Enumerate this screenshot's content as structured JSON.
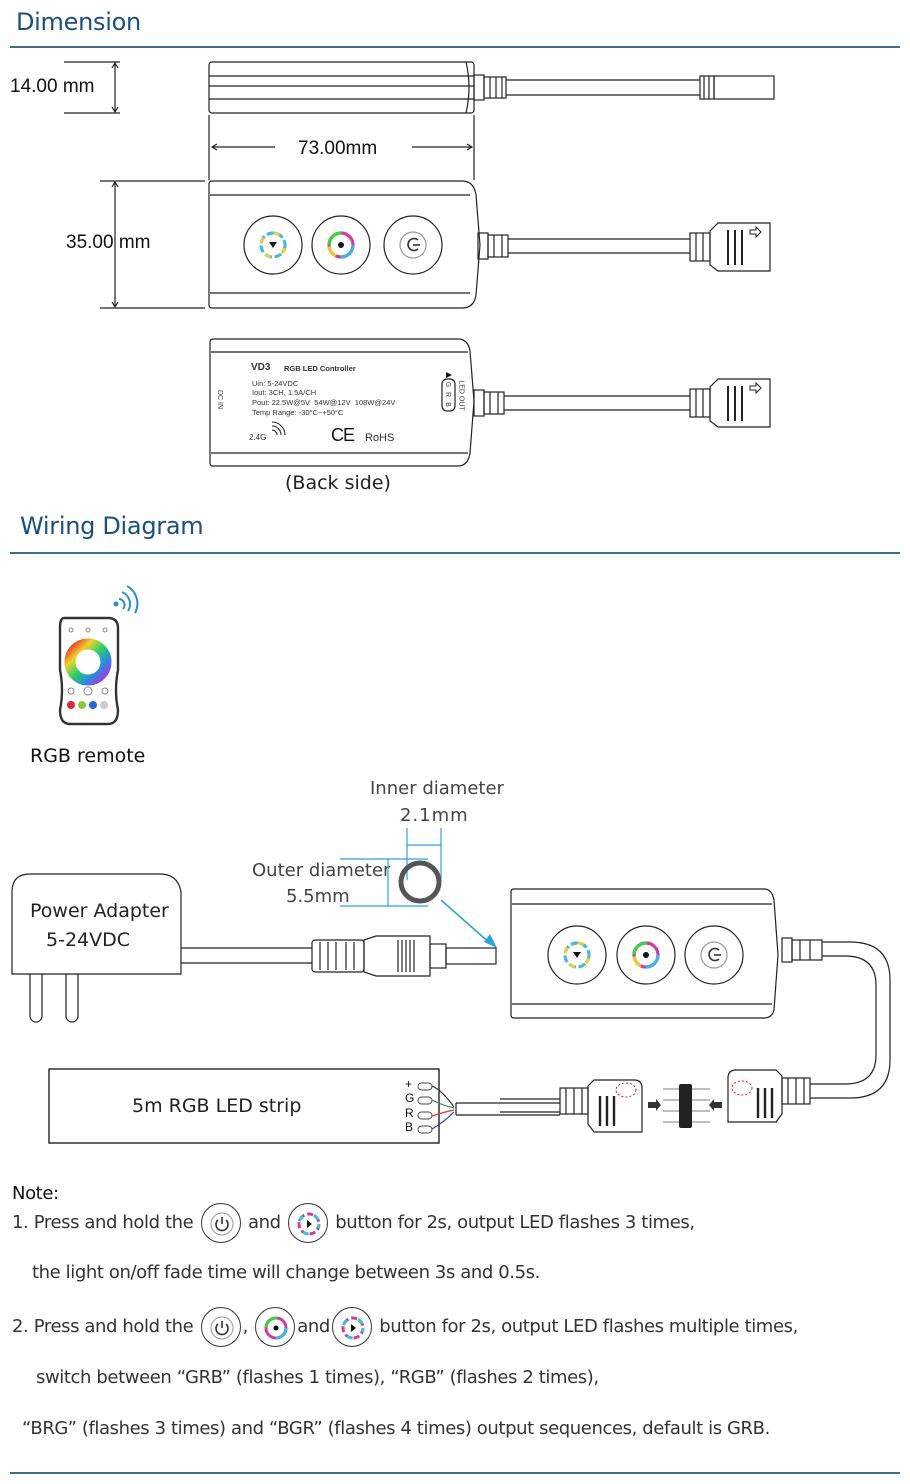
{
  "dimension": {
    "title": "Dimension",
    "height_label": "14.00 mm",
    "length_label": "73.00mm",
    "width_label": "35.00 mm",
    "back_side_caption": "(Back side)",
    "label_plate": {
      "model": "VD3",
      "product": "RGB LED Controller",
      "specs": [
        "Uin: 5-24VDC",
        "Iout: 3CH, 1.5A/CH",
        "Pout: 22.5W@5V  54W@12V  108W@24V",
        "Temp Range: -30°C~+50°C"
      ],
      "wireless": "2.4G",
      "cert_ce": "CE",
      "cert_rohs": "RoHS",
      "dc_in": "DC IN",
      "led_out": "LED OUT",
      "pins": [
        "G",
        "R",
        "B"
      ]
    },
    "buttons": [
      "mode-button",
      "color-button",
      "power-button"
    ]
  },
  "wiring": {
    "title": "Wiring Diagram",
    "remote_label": "RGB remote",
    "inner_diameter_label": "Inner diameter",
    "inner_diameter_value": "2.1mm",
    "outer_diameter_label": "Outer diameter",
    "outer_diameter_value": "5.5mm",
    "adapter_line1": "Power Adapter",
    "adapter_line2": "5-24VDC",
    "strip_label": "5m RGB LED strip",
    "strip_pins": [
      "+",
      "G",
      "R",
      "B"
    ],
    "wire_colors": {
      "plus": "#222222",
      "g": "#2e8b57",
      "r": "#d23c3c",
      "b": "#2c3a8c"
    },
    "accent": "#2aa5d8"
  },
  "notes": {
    "heading": "Note:",
    "note1_a": "1. Press and hold the",
    "note1_b": "and",
    "note1_c": "button for 2s, output LED flashes 3 times,",
    "note1_line2": "the light on/off fade time will change between 3s and 0.5s.",
    "note2_a": "2. Press and hold the",
    "note2_comma": ",",
    "note2_b": "and",
    "note2_c": "button for 2s, output LED flashes multiple times,",
    "note2_line2": "switch between “GRB” (flashes 1 times), “RGB” (flashes 2 times),",
    "note2_line3": "“BRG” (flashes 3 times) and “BGR”  (flashes 4 times) output sequences, default is GRB."
  },
  "colors": {
    "heading": "#1c4f7d",
    "rule": "#3f6f8f"
  }
}
